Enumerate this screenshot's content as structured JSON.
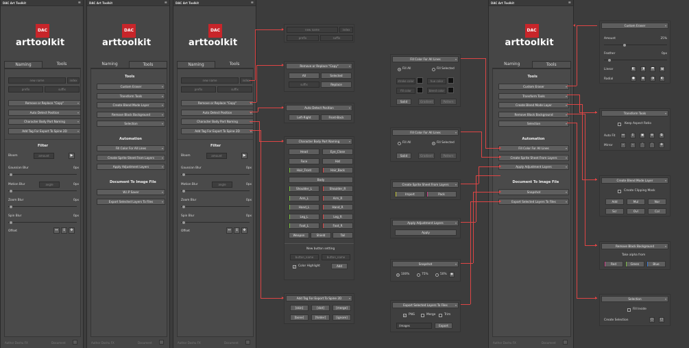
{
  "app_title": "DAC Art Toolkit",
  "logo_mark": "DAC",
  "logo_text": "arttoolkit",
  "tabs": {
    "naming": "Naming",
    "tools": "Tools"
  },
  "naming_panel": {
    "new_name_placeholder": "new name",
    "index_placeholder": "index",
    "prefix_placeholder": "prefix",
    "suffix_placeholder": "suffix",
    "buttons": [
      "Remove or Replace \"Copy\"",
      "Auto Detect Position",
      "Character Body Part Naming",
      "Add Tag For Export To Spine 2D"
    ]
  },
  "filter": {
    "title": "Filter",
    "bloom_label": "Bloom",
    "bloom_placeholder": "amount",
    "gaussian_label": "Gaussian Blur",
    "gaussian_value": "0px",
    "motion_label": "Motion Blur",
    "motion_placeholder": "angle",
    "motion_value": "0px",
    "zoom_label": "Zoom Blur",
    "zoom_value": "0px",
    "spin_label": "Spin Blur",
    "spin_value": "0px",
    "offset_label": "Offset"
  },
  "tools_panel": {
    "tools_header": "Tools",
    "tools_buttons": [
      "Custom Eraser",
      "Transform Tools",
      "Create Blend Mode Layer",
      "Remove Black Background",
      "Selection"
    ],
    "automation_header": "Automation",
    "automation_buttons": [
      "Fill Color For All Lines",
      "Create Sprite Sheet From Layers",
      "Apply Adjustment Layers"
    ],
    "doc_header": "Document To Image File",
    "doc_buttons": [
      "W.I.P Saver",
      "Export Selected Layers To Files"
    ],
    "doc_buttons_right": [
      "Snapshot",
      "Export Selected Layers To Files"
    ]
  },
  "footer": {
    "author": "Author Doshu FX",
    "document": "Document"
  },
  "naming_popups": {
    "top": {
      "new_name": "new name",
      "index": "index",
      "prefix": "prefix",
      "suffix": "suffix"
    },
    "remove_copy": {
      "title": "Remove or Replace \"Copy\"",
      "all": "All",
      "selected": "Selected",
      "suffix": "suffix",
      "replace": "Replace"
    },
    "auto_detect": {
      "title": "Auto Detect Position",
      "left_right": "Left-Right",
      "front_back": "Front-Back"
    },
    "body_part": {
      "title": "Character Body Part Naming",
      "head": "Head",
      "eye_close": "Eye_Close",
      "face": "Face",
      "hat": "Hat",
      "hair_front": "Hair_Front",
      "hair_back": "Hair_Back",
      "body": "Body",
      "shoulder_l": "Shoulder_L",
      "shoulder_r": "Shoulder_R",
      "arm_l": "Arm_L",
      "arm_r": "Arm_R",
      "hand_l": "Hand_L",
      "hand_r": "Hand_R",
      "leg_l": "Leg_L",
      "leg_r": "Leg_R",
      "foot_l": "Foot_L",
      "foot_r": "Foot_R",
      "weapon": "Weapon",
      "shield": "Shield",
      "tail": "Tail",
      "new_button_setting": "New button setting",
      "button_name": "button_name",
      "color_highlight": "Color Highlight",
      "add": "Add"
    },
    "spine_tags": {
      "title": "Add Tag For Export To Spine 2D",
      "tags": [
        "[skin]",
        "[slot]",
        "[merge]",
        "[bone]",
        "[folder]",
        "[ignore]"
      ]
    }
  },
  "automation_popups": {
    "fill1": {
      "title": "Fill Color For All Lines",
      "fill_all": "Fill All",
      "fill_selected": "Fill Selected",
      "stroke_color": "stroke color",
      "hue_color": "hue color",
      "solid": "Solid",
      "gradient": "Gradient",
      "pattern": "Pattern",
      "fill_color": "fill color",
      "blend_color": "blend color"
    },
    "fill2": {
      "title": "Fill Color For All Lines",
      "fill_all": "Fill All",
      "fill_selected": "Fill Selected",
      "solid": "Solid",
      "gradient": "Gradient",
      "pattern": "Pattern"
    },
    "sprite": {
      "title": "Create Sprite Sheet From Layers",
      "import": "Import",
      "pack": "Pack"
    },
    "adjust": {
      "title": "Apply Adjustment Layers",
      "apply": "Apply"
    },
    "snapshot": {
      "title": "Snapshot",
      "p100": "100%",
      "p75": "75%",
      "p50": "50%"
    },
    "export": {
      "title": "Export Selected Layers To Files",
      "png": "PNG",
      "merge": "Merge",
      "trim": "Trim",
      "path": "/images",
      "export": "Export"
    }
  },
  "tools_popups": {
    "eraser": {
      "title": "Custom Eraser",
      "amount": "Amount",
      "amount_value": "25%",
      "feather": "Feather",
      "feather_value": "0px",
      "linear": "Linear",
      "radial": "Radial"
    },
    "transform": {
      "title": "Transform Tools",
      "keep_aspect": "Keep Aspect Ratio",
      "auto_fit": "Auto Fit",
      "mirror": "Mirror"
    },
    "blend": {
      "title": "Create Blend Mode Layer",
      "clipping": "Create Clipping Mask",
      "modes": [
        "Add",
        "Mul",
        "Nor",
        "Scr",
        "Ovl",
        "Col"
      ]
    },
    "black_bg": {
      "title": "Remove Black Background",
      "take_alpha": "Take alpha from",
      "red": "Red",
      "green": "Green",
      "blue": "Blue"
    },
    "selection": {
      "title": "Selection",
      "fill_inside": "Fill Inside",
      "create_selection": "Create Selection"
    }
  },
  "colors": {
    "accent_red": "#e04545",
    "green": "#7bc043",
    "blue": "#3a7bd5",
    "pink": "#d0408a",
    "yellow": "#c9c93a",
    "bg": "#3c3c3c",
    "panel": "#464646"
  }
}
